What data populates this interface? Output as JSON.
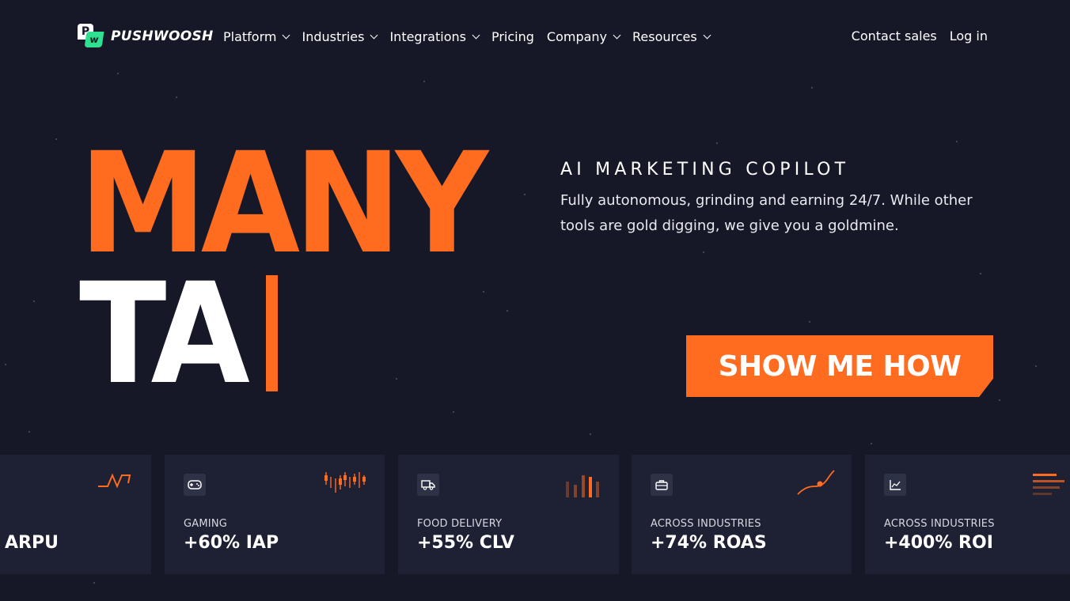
{
  "brand": {
    "name": "PUSHWOOSH",
    "logo_p": "P",
    "logo_w": "w"
  },
  "nav": {
    "items": [
      {
        "label": "Platform",
        "dropdown": true
      },
      {
        "label": "Industries",
        "dropdown": true
      },
      {
        "label": "Integrations",
        "dropdown": true
      },
      {
        "label": "Pricing",
        "dropdown": false
      },
      {
        "label": "Company",
        "dropdown": true
      },
      {
        "label": "Resources",
        "dropdown": true
      }
    ],
    "contact_sales": "Contact sales",
    "log_in": "Log in"
  },
  "hero": {
    "headline_line1": "MANY",
    "headline_line2": "TA",
    "eyebrow": "AI MARKETING COPILOT",
    "subtitle": "Fully autonomous, grinding and earning 24/7. While other tools are gold digging, we give you a goldmine.",
    "cta_label": "SHOW ME HOW"
  },
  "cards": [
    {
      "category": "",
      "metric": "ARPU",
      "icon": "",
      "graph": "step-line"
    },
    {
      "category": "GAMING",
      "metric": "+60% IAP",
      "icon": "gamepad-icon",
      "graph": "candlestick"
    },
    {
      "category": "FOOD DELIVERY",
      "metric": "+55% CLV",
      "icon": "truck-icon",
      "graph": "bars"
    },
    {
      "category": "ACROSS INDUSTRIES",
      "metric": "+74% ROAS",
      "icon": "briefcase-icon",
      "graph": "rising-curve"
    },
    {
      "category": "ACROSS INDUSTRIES",
      "metric": "+400% ROI",
      "icon": "chart-icon",
      "graph": "horizontal-bars"
    }
  ],
  "colors": {
    "background": "#161827",
    "accent": "#ff6b1f",
    "card": "#1e2133",
    "logo_green": "#2ee08f"
  }
}
